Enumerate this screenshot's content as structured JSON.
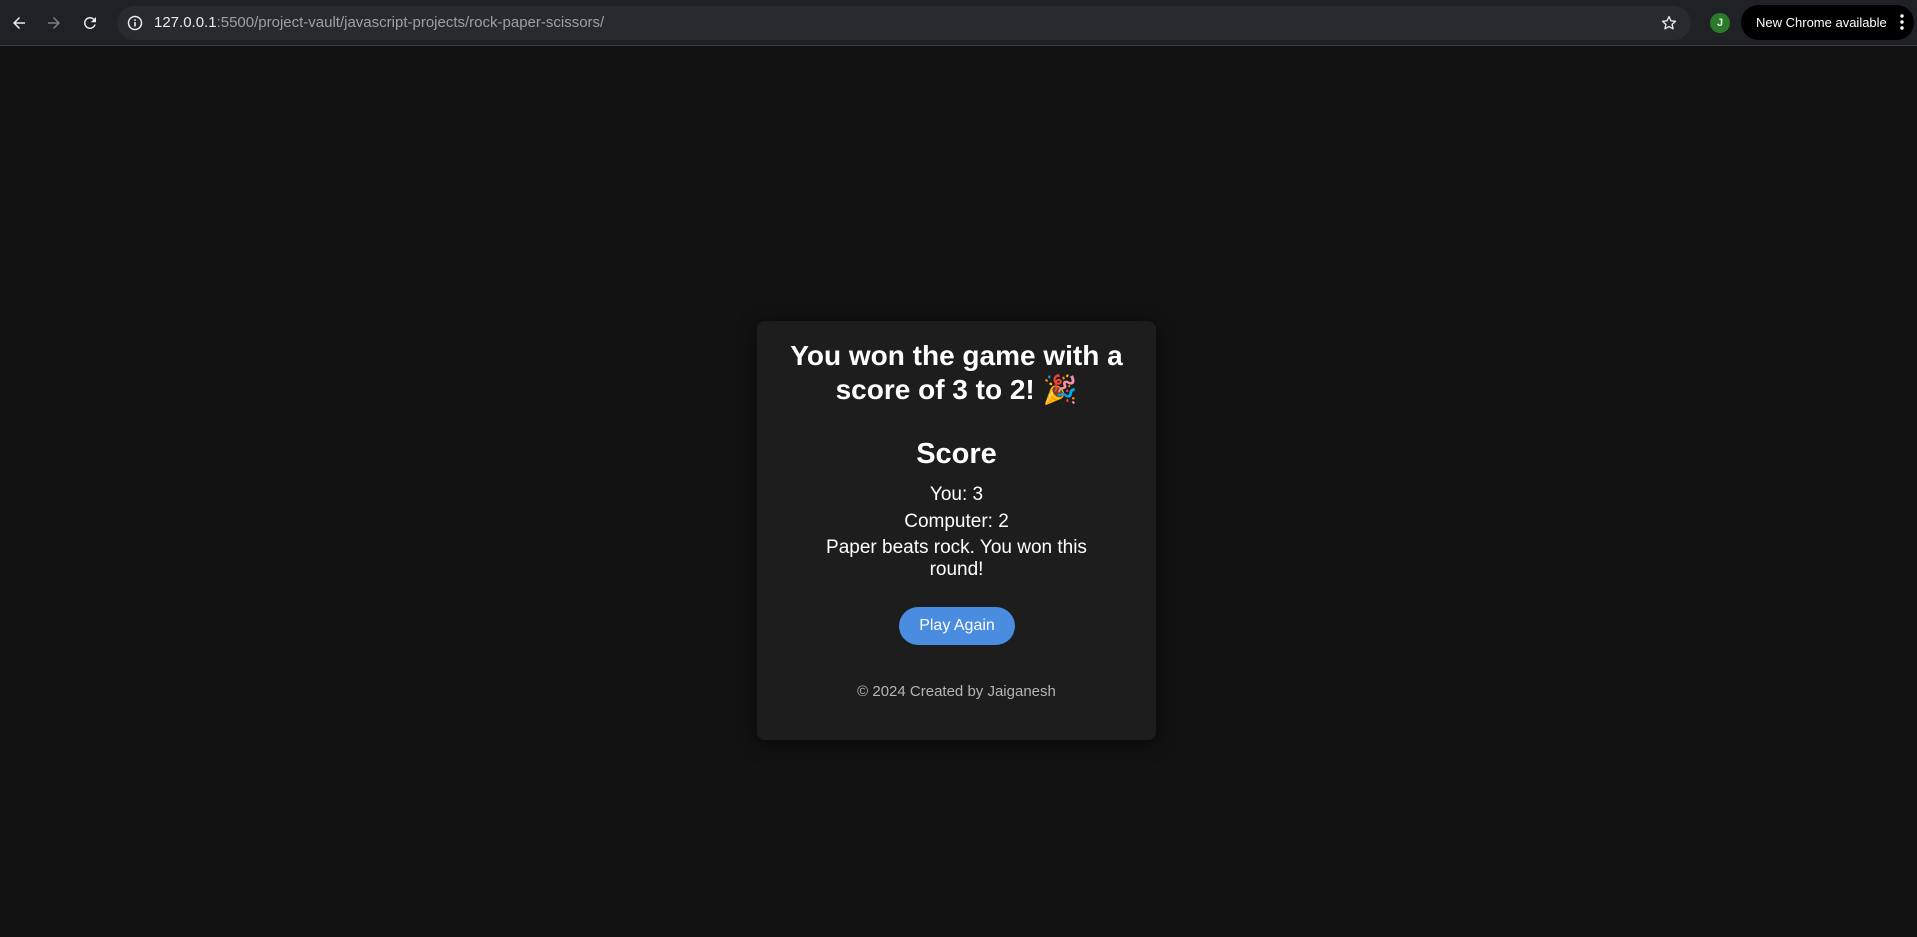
{
  "browser": {
    "url_host": "127.0.0.1",
    "url_path": ":5500/project-vault/javascript-projects/rock-paper-scissors/",
    "profile_initial": "J",
    "update_label": "New Chrome available",
    "icons": [
      "back-icon",
      "forward-icon",
      "reload-icon",
      "site-info-icon",
      "bookmark-star-icon",
      "more-menu-icon"
    ]
  },
  "game": {
    "result_title": "You won the game with a score of 3 to 2! 🎉",
    "score_heading": "Score",
    "you_score": "You: 3",
    "computer_score": "Computer: 2",
    "round_message": "Paper beats rock. You won this round!",
    "play_again_label": "Play Again",
    "footer": "© 2024 Created by Jaiganesh"
  },
  "colors": {
    "page_bg": "#121212",
    "card_bg": "#1d1d1d",
    "button_bg": "#4a8ce0"
  }
}
